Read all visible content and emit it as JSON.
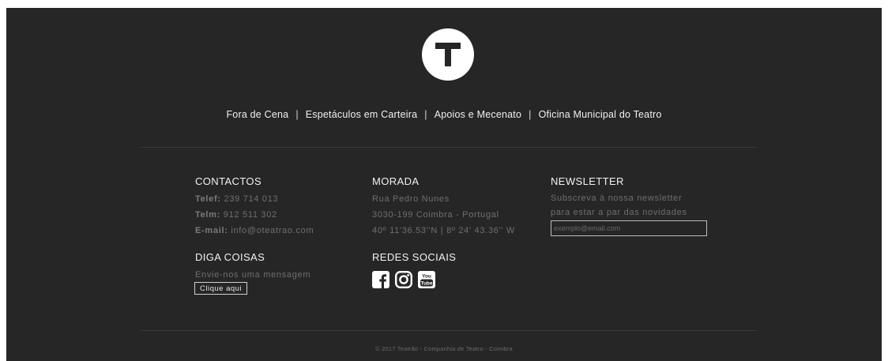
{
  "logo": {
    "letter": "T"
  },
  "nav": {
    "items": [
      {
        "label": "Fora de Cena"
      },
      {
        "label": "Espetáculos em Carteira"
      },
      {
        "label": "Apoios e Mecenato"
      },
      {
        "label": "Oficina Municipal do Teatro"
      }
    ],
    "separator": "|"
  },
  "contactos": {
    "heading": "CONTACTOS",
    "telef_label": "Telef:",
    "telef_value": "239 714 013",
    "telm_label": "Telm:",
    "telm_value": "912 511 302",
    "email_label": "E-mail:",
    "email_value": "info@oteatrao.com"
  },
  "morada": {
    "heading": "MORADA",
    "line1": "Rua Pedro Nunes",
    "line2": "3030-199 Coimbra - Portugal",
    "line3": "40º 11'36.53''N | 8º 24' 43.36'' W"
  },
  "newsletter": {
    "heading": "NEWSLETTER",
    "line1": "Subscreva à nossa newsletter",
    "line2": "para estar a par das novidades",
    "email_placeholder": "exemplo@email.com",
    "email_value": ""
  },
  "diga": {
    "heading": "DIGA COISAS",
    "text": "Envie-nos uma mensagem",
    "button_label": "Clique aqui"
  },
  "redes": {
    "heading": "REDES SOCIAIS",
    "icons": [
      "facebook-icon",
      "instagram-icon",
      "youtube-icon"
    ],
    "youtube_top": "You",
    "youtube_bottom": "Tube"
  },
  "copyright": "© 2017 Teatrão - Companhia de Teatro - Coimbra",
  "colors": {
    "background": "#262626",
    "heading": "#f2f2f2",
    "muted": "#6f6f6f"
  }
}
